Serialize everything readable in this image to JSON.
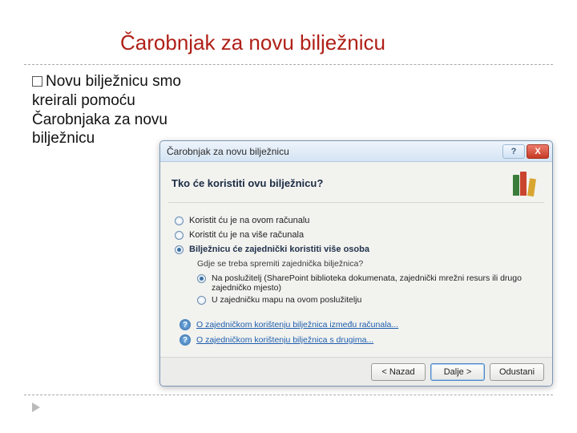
{
  "slide": {
    "title": "Čarobnjak za novu bilježnicu",
    "bullet": "Novu bilježnicu smo kreirali pomoću Čarobnjaka za novu bilježnicu"
  },
  "dialog": {
    "title": "Čarobnjak za novu bilježnicu",
    "help_glyph": "?",
    "close_glyph": "X",
    "heading": "Tko će koristiti ovu bilježnicu?",
    "options": {
      "opt1": "Koristit ću je na ovom računalu",
      "opt2": "Koristit ću je na više računala",
      "opt3": "Bilježnicu će zajednički koristiti više osoba"
    },
    "sub_question": "Gdje se treba spremiti zajednička bilježnica?",
    "sub_options": {
      "s1": "Na poslužitelj (SharePoint biblioteka dokumenata, zajednički mrežni resurs ili drugo zajedničko mjesto)",
      "s2": "U zajedničku mapu na ovom poslužitelju"
    },
    "links": {
      "l1": "O zajedničkom korištenju bilježnica između računala...",
      "l2": "O zajedničkom korištenju bilježnica s drugima..."
    },
    "buttons": {
      "back": "< Nazad",
      "next": "Dalje >",
      "cancel": "Odustani"
    }
  }
}
